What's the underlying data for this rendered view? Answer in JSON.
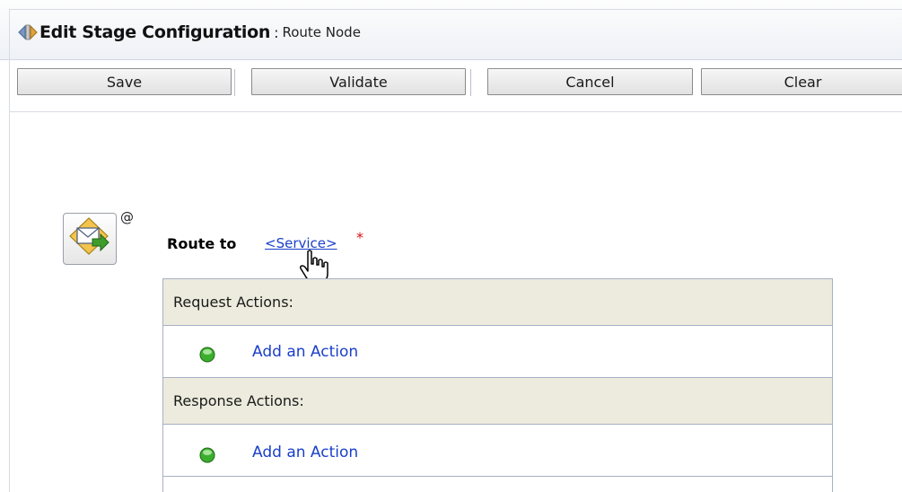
{
  "header": {
    "title": "Edit Stage Configuration",
    "separator": ":",
    "subtitle": "Route Node"
  },
  "toolbar": {
    "save_label": "Save",
    "validate_label": "Validate",
    "cancel_label": "Cancel",
    "clear_label": "Clear"
  },
  "route": {
    "icon": "route-envelope-icon",
    "at_symbol": "@",
    "label": "Route to",
    "service_link": "<Service>",
    "required_marker": "*"
  },
  "request_section": {
    "header": "Request Actions:",
    "add_action": "Add an Action"
  },
  "response_section": {
    "header": "Response Actions:",
    "add_action": "Add an Action"
  },
  "colors": {
    "link": "#1a3fc8",
    "section_header_bg": "#ecebdd",
    "required": "#e01010",
    "add_icon_green": "#3cae2e"
  }
}
